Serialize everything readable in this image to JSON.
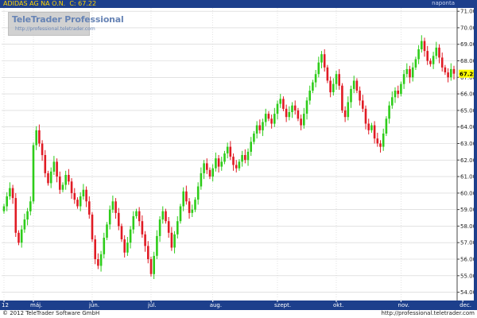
{
  "header": {
    "symbol": "ADIDAS AG NA O.N.",
    "close_label": "C:",
    "close_value": "67.22",
    "period": "naponta"
  },
  "watermark": {
    "title": "TeleTrader Professional",
    "url": "http://professional.teletrader.com"
  },
  "footer": {
    "copyright": "© 2012 TeleTrader Software GmbH",
    "source": "http://professional.teletrader.com"
  },
  "colors": {
    "up": "#2ecc1a",
    "down": "#e01b24",
    "grid": "#d0d0d0",
    "axis_bg": "#1d3f8c",
    "price_tag": "#ffff00"
  },
  "chart_data": {
    "type": "candlestick",
    "title": "",
    "xlabel": "",
    "ylabel": "",
    "ylim": [
      53.5,
      71.2
    ],
    "y_ticks": [
      54,
      55,
      56,
      57,
      58,
      59,
      60,
      61,
      62,
      63,
      64,
      65,
      66,
      67,
      68,
      69,
      70,
      71
    ],
    "y_tick_labels": [
      "54.00",
      "55.00",
      "56.00",
      "57.00",
      "58.00",
      "59.00",
      "60.00",
      "61.00",
      "62.00",
      "63.00",
      "64.00",
      "65.00",
      "66.00",
      "67.00",
      "68.00",
      "69.00",
      "70.00",
      "71.00"
    ],
    "grid": true,
    "last_price": 67.22,
    "last_price_label": "67.22",
    "x_ticks": [
      {
        "label": "12",
        "index": 0
      },
      {
        "label": "máj.",
        "index": 10
      },
      {
        "label": "jún.",
        "index": 30
      },
      {
        "label": "júl.",
        "index": 50
      },
      {
        "label": "aug.",
        "index": 71
      },
      {
        "label": "szept.",
        "index": 93
      },
      {
        "label": "okt.",
        "index": 113
      },
      {
        "label": "nov.",
        "index": 135
      },
      {
        "label": "dec.",
        "index": 156
      }
    ],
    "closes": [
      59.2,
      59.8,
      60.3,
      59.7,
      57.6,
      57.0,
      57.8,
      58.4,
      58.9,
      59.5,
      62.9,
      63.8,
      63.0,
      62.3,
      61.2,
      60.6,
      61.3,
      61.9,
      61.0,
      60.2,
      60.5,
      61.1,
      60.7,
      60.0,
      59.6,
      59.2,
      59.8,
      60.2,
      59.5,
      58.7,
      57.2,
      56.0,
      55.6,
      56.3,
      57.3,
      58.1,
      59.0,
      59.5,
      58.8,
      58.0,
      57.2,
      56.4,
      57.0,
      57.8,
      58.6,
      58.9,
      58.3,
      57.5,
      56.8,
      56.0,
      55.1,
      56.2,
      57.4,
      58.4,
      58.9,
      58.3,
      57.6,
      56.7,
      57.5,
      58.3,
      59.2,
      60.1,
      59.5,
      58.8,
      59.0,
      59.6,
      60.4,
      61.2,
      61.8,
      61.4,
      61.0,
      61.5,
      62.1,
      61.6,
      61.9,
      62.4,
      62.8,
      62.2,
      61.7,
      61.5,
      61.9,
      62.3,
      62.0,
      62.5,
      63.1,
      63.6,
      64.1,
      63.8,
      64.3,
      64.8,
      64.5,
      64.2,
      64.8,
      65.4,
      65.7,
      65.1,
      64.6,
      64.9,
      65.3,
      65.0,
      64.5,
      64.1,
      64.8,
      65.6,
      66.2,
      66.7,
      67.2,
      67.9,
      68.4,
      67.6,
      66.8,
      66.1,
      66.6,
      67.2,
      66.5,
      65.0,
      64.6,
      65.5,
      66.3,
      66.8,
      66.2,
      65.6,
      65.1,
      64.2,
      63.8,
      64.1,
      63.3,
      63.0,
      62.8,
      63.6,
      64.5,
      65.3,
      65.8,
      66.2,
      66.0,
      66.6,
      67.2,
      67.5,
      67.0,
      67.6,
      68.1,
      68.7,
      69.2,
      68.6,
      68.0,
      67.8,
      68.3,
      68.8,
      68.2,
      67.6,
      67.3,
      67.0,
      67.5,
      67.22
    ],
    "series": []
  }
}
